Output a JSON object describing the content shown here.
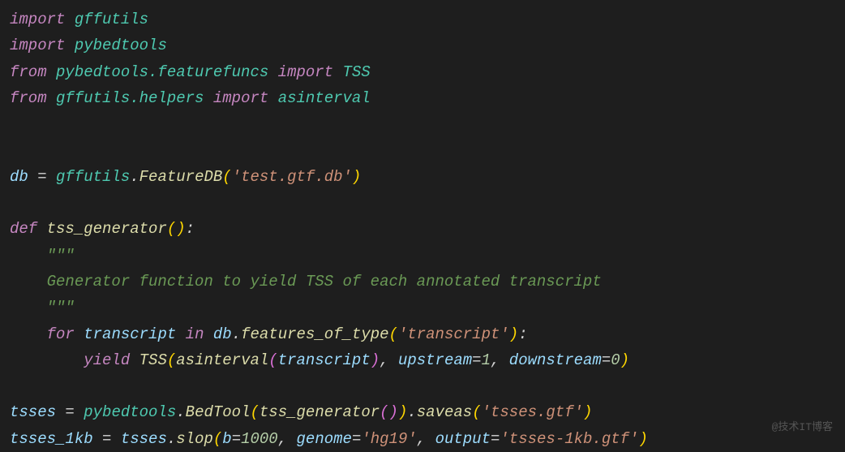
{
  "code": {
    "line1": {
      "import": "import",
      "module": "gffutils"
    },
    "line2": {
      "import": "import",
      "module": "pybedtools"
    },
    "line3": {
      "from": "from",
      "module": "pybedtools.featurefuncs",
      "import": "import",
      "name": "TSS"
    },
    "line4": {
      "from": "from",
      "module": "gffutils.helpers",
      "import": "import",
      "name": "asinterval"
    },
    "line7": {
      "var": "db",
      "eq": " = ",
      "mod": "gffutils",
      "dot": ".",
      "func": "FeatureDB",
      "str": "'test.gtf.db'"
    },
    "line9": {
      "def": "def",
      "name": "tss_generator"
    },
    "line10": {
      "doc": "\"\"\""
    },
    "line11": {
      "doc": "Generator function to yield TSS of each annotated transcript"
    },
    "line12": {
      "doc": "\"\"\""
    },
    "line13": {
      "for": "for",
      "var": "transcript",
      "in": "in",
      "obj": "db",
      "dot": ".",
      "method": "features_of_type",
      "str": "'transcript'"
    },
    "line14": {
      "yield": "yield",
      "func": "TSS",
      "func2": "asinterval",
      "arg": "transcript",
      "p1": "upstream",
      "v1": "1",
      "p2": "downstream",
      "v2": "0"
    },
    "line16": {
      "var": "tsses",
      "mod": "pybedtools",
      "func": "BedTool",
      "arg": "tss_generator",
      "method": "saveas",
      "str": "'tsses.gtf'"
    },
    "line17": {
      "var": "tsses_1kb",
      "obj": "tsses",
      "method": "slop",
      "p1": "b",
      "v1": "1000",
      "p2": "genome",
      "s2": "'hg19'",
      "p3": "output",
      "s3": "'tsses-1kb.gtf'"
    }
  },
  "watermark": "@技术IT博客"
}
